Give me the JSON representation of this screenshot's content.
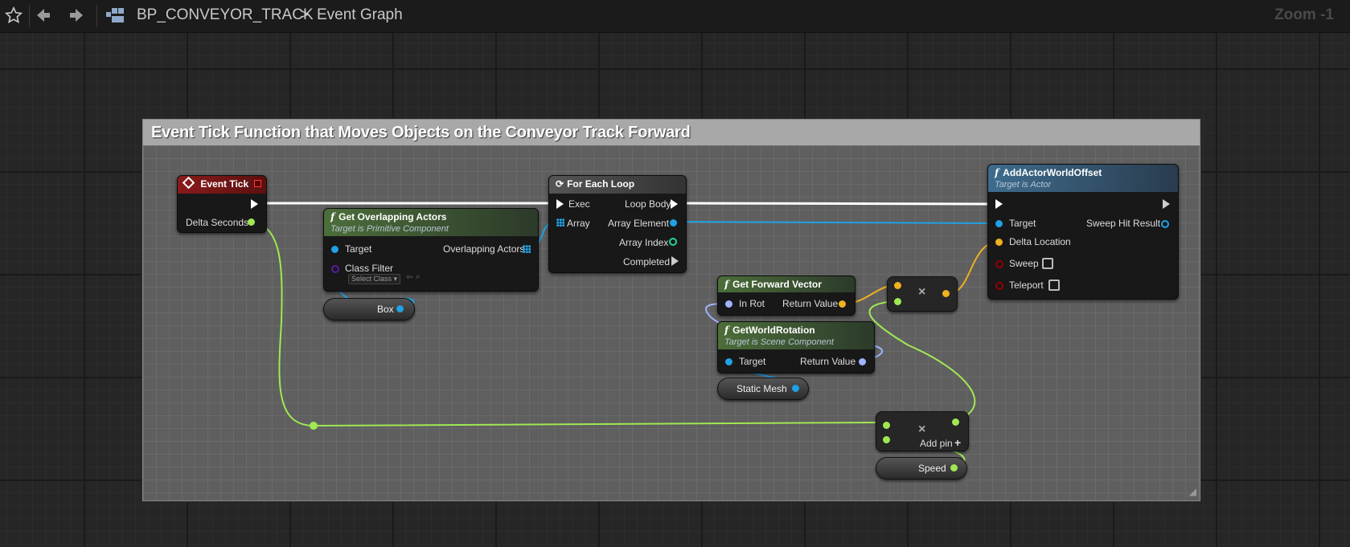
{
  "toolbar": {
    "breadcrumb_blueprint": "BP_CONVEYOR_TRACK",
    "breadcrumb_separator": ">",
    "breadcrumb_graph": "Event Graph",
    "zoom": "Zoom -1"
  },
  "comment": {
    "title": "Event Tick Function that Moves Objects on the Conveyor Track Forward"
  },
  "event_tick": {
    "title": "Event Tick",
    "delta_seconds": "Delta Seconds"
  },
  "get_overlapping": {
    "title": "Get Overlapping Actors",
    "subtitle": "Target is Primitive Component",
    "target": "Target",
    "overlapping_actors": "Overlapping Actors",
    "class_filter": "Class Filter",
    "select_class": "Select Class"
  },
  "box_var": {
    "label": "Box"
  },
  "for_each": {
    "title": "For Each Loop",
    "exec": "Exec",
    "array": "Array",
    "loop_body": "Loop Body",
    "array_element": "Array Element",
    "array_index": "Array Index",
    "completed": "Completed"
  },
  "forward_vector": {
    "title": "Get Forward Vector",
    "in_rot": "In Rot",
    "return_value": "Return Value"
  },
  "world_rotation": {
    "title": "GetWorldRotation",
    "subtitle": "Target is Scene Component",
    "target": "Target",
    "return_value": "Return Value"
  },
  "static_mesh_var": {
    "label": "Static Mesh"
  },
  "multiply_vector": {
    "symbol": "×"
  },
  "multiply_float": {
    "symbol": "×",
    "add_pin": "Add pin",
    "add_symbol": "+"
  },
  "speed_var": {
    "label": "Speed"
  },
  "add_offset": {
    "title": "AddActorWorldOffset",
    "subtitle": "Target is Actor",
    "target": "Target",
    "delta_location": "Delta Location",
    "sweep": "Sweep",
    "teleport": "Teleport",
    "sweep_hit_result": "Sweep Hit Result"
  },
  "colors": {
    "exec": "#ffffff",
    "float": "#a0e852",
    "object": "#1fa1e6",
    "vector": "#f0b020",
    "rotator": "#a0b4ff",
    "int": "#1fd6a0",
    "class": "#5a1aa0",
    "bool": "#950000"
  }
}
